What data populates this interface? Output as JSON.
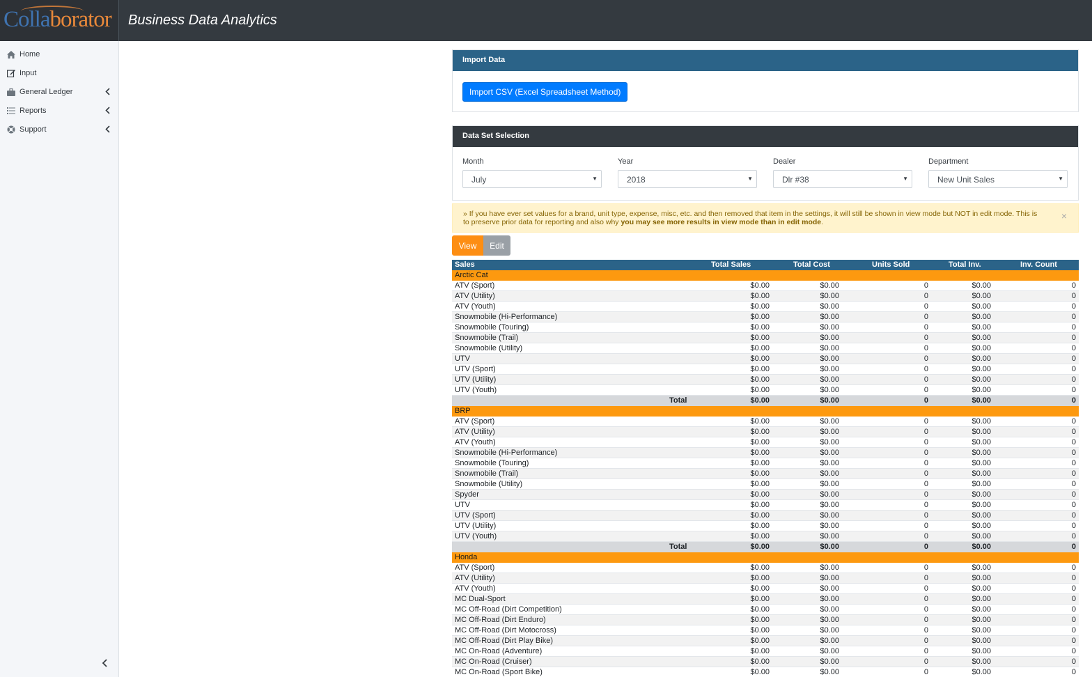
{
  "header": {
    "logo_part1": "Colla",
    "logo_part2": "borator",
    "title": "Business Data Analytics"
  },
  "sidebar": {
    "items": [
      {
        "label": "Home",
        "icon": "home-icon",
        "has_chevron": false
      },
      {
        "label": "Input",
        "icon": "edit-icon",
        "has_chevron": false
      },
      {
        "label": "General Ledger",
        "icon": "briefcase-icon",
        "has_chevron": true
      },
      {
        "label": "Reports",
        "icon": "list-icon",
        "has_chevron": true
      },
      {
        "label": "Support",
        "icon": "support-icon",
        "has_chevron": true
      }
    ]
  },
  "import_card": {
    "title": "Import Data",
    "button_label": "Import CSV (Excel Spreadsheet Method)"
  },
  "dataset_card": {
    "title": "Data Set Selection",
    "fields": [
      {
        "label": "Month",
        "value": "July"
      },
      {
        "label": "Year",
        "value": "2018"
      },
      {
        "label": "Dealer",
        "value": "Dlr #38"
      },
      {
        "label": "Department",
        "value": "New Unit Sales"
      }
    ]
  },
  "alert": {
    "text_main": "» If you have ever set values for a brand, unit type, expense, misc, etc. and then removed that item in the settings, it will still be shown in view mode but NOT in edit mode. This is to preserve prior data for reporting and also why ",
    "text_bold": "you may see more results in view mode than in edit mode",
    "text_end": ".",
    "close": "×"
  },
  "mode_toggle": {
    "view_label": "View",
    "edit_label": "Edit",
    "active": "View"
  },
  "table": {
    "headers": [
      "Sales",
      "Total Sales",
      "Total Cost",
      "Units Sold",
      "Total Inv.",
      "Inv. Count"
    ],
    "total_label": "Total",
    "groups": [
      {
        "brand": "Arctic Cat",
        "rows": [
          {
            "name": "ATV (Sport)",
            "sales": "$0.00",
            "cost": "$0.00",
            "units": "0",
            "inv": "$0.00",
            "inv_count": "0"
          },
          {
            "name": "ATV (Utility)",
            "sales": "$0.00",
            "cost": "$0.00",
            "units": "0",
            "inv": "$0.00",
            "inv_count": "0"
          },
          {
            "name": "ATV (Youth)",
            "sales": "$0.00",
            "cost": "$0.00",
            "units": "0",
            "inv": "$0.00",
            "inv_count": "0"
          },
          {
            "name": "Snowmobile (Hi-Performance)",
            "sales": "$0.00",
            "cost": "$0.00",
            "units": "0",
            "inv": "$0.00",
            "inv_count": "0"
          },
          {
            "name": "Snowmobile (Touring)",
            "sales": "$0.00",
            "cost": "$0.00",
            "units": "0",
            "inv": "$0.00",
            "inv_count": "0"
          },
          {
            "name": "Snowmobile (Trail)",
            "sales": "$0.00",
            "cost": "$0.00",
            "units": "0",
            "inv": "$0.00",
            "inv_count": "0"
          },
          {
            "name": "Snowmobile (Utility)",
            "sales": "$0.00",
            "cost": "$0.00",
            "units": "0",
            "inv": "$0.00",
            "inv_count": "0"
          },
          {
            "name": "UTV",
            "sales": "$0.00",
            "cost": "$0.00",
            "units": "0",
            "inv": "$0.00",
            "inv_count": "0"
          },
          {
            "name": "UTV (Sport)",
            "sales": "$0.00",
            "cost": "$0.00",
            "units": "0",
            "inv": "$0.00",
            "inv_count": "0"
          },
          {
            "name": "UTV (Utility)",
            "sales": "$0.00",
            "cost": "$0.00",
            "units": "0",
            "inv": "$0.00",
            "inv_count": "0"
          },
          {
            "name": "UTV (Youth)",
            "sales": "$0.00",
            "cost": "$0.00",
            "units": "0",
            "inv": "$0.00",
            "inv_count": "0"
          }
        ],
        "total": {
          "sales": "$0.00",
          "cost": "$0.00",
          "units": "0",
          "inv": "$0.00",
          "inv_count": "0"
        }
      },
      {
        "brand": "BRP",
        "rows": [
          {
            "name": "ATV (Sport)",
            "sales": "$0.00",
            "cost": "$0.00",
            "units": "0",
            "inv": "$0.00",
            "inv_count": "0"
          },
          {
            "name": "ATV (Utility)",
            "sales": "$0.00",
            "cost": "$0.00",
            "units": "0",
            "inv": "$0.00",
            "inv_count": "0"
          },
          {
            "name": "ATV (Youth)",
            "sales": "$0.00",
            "cost": "$0.00",
            "units": "0",
            "inv": "$0.00",
            "inv_count": "0"
          },
          {
            "name": "Snowmobile (Hi-Performance)",
            "sales": "$0.00",
            "cost": "$0.00",
            "units": "0",
            "inv": "$0.00",
            "inv_count": "0"
          },
          {
            "name": "Snowmobile (Touring)",
            "sales": "$0.00",
            "cost": "$0.00",
            "units": "0",
            "inv": "$0.00",
            "inv_count": "0"
          },
          {
            "name": "Snowmobile (Trail)",
            "sales": "$0.00",
            "cost": "$0.00",
            "units": "0",
            "inv": "$0.00",
            "inv_count": "0"
          },
          {
            "name": "Snowmobile (Utility)",
            "sales": "$0.00",
            "cost": "$0.00",
            "units": "0",
            "inv": "$0.00",
            "inv_count": "0"
          },
          {
            "name": "Spyder",
            "sales": "$0.00",
            "cost": "$0.00",
            "units": "0",
            "inv": "$0.00",
            "inv_count": "0"
          },
          {
            "name": "UTV",
            "sales": "$0.00",
            "cost": "$0.00",
            "units": "0",
            "inv": "$0.00",
            "inv_count": "0"
          },
          {
            "name": "UTV (Sport)",
            "sales": "$0.00",
            "cost": "$0.00",
            "units": "0",
            "inv": "$0.00",
            "inv_count": "0"
          },
          {
            "name": "UTV (Utility)",
            "sales": "$0.00",
            "cost": "$0.00",
            "units": "0",
            "inv": "$0.00",
            "inv_count": "0"
          },
          {
            "name": "UTV (Youth)",
            "sales": "$0.00",
            "cost": "$0.00",
            "units": "0",
            "inv": "$0.00",
            "inv_count": "0"
          }
        ],
        "total": {
          "sales": "$0.00",
          "cost": "$0.00",
          "units": "0",
          "inv": "$0.00",
          "inv_count": "0"
        }
      },
      {
        "brand": "Honda",
        "rows": [
          {
            "name": "ATV (Sport)",
            "sales": "$0.00",
            "cost": "$0.00",
            "units": "0",
            "inv": "$0.00",
            "inv_count": "0"
          },
          {
            "name": "ATV (Utility)",
            "sales": "$0.00",
            "cost": "$0.00",
            "units": "0",
            "inv": "$0.00",
            "inv_count": "0"
          },
          {
            "name": "ATV (Youth)",
            "sales": "$0.00",
            "cost": "$0.00",
            "units": "0",
            "inv": "$0.00",
            "inv_count": "0"
          },
          {
            "name": "MC Dual-Sport",
            "sales": "$0.00",
            "cost": "$0.00",
            "units": "0",
            "inv": "$0.00",
            "inv_count": "0"
          },
          {
            "name": "MC Off-Road (Dirt Competition)",
            "sales": "$0.00",
            "cost": "$0.00",
            "units": "0",
            "inv": "$0.00",
            "inv_count": "0"
          },
          {
            "name": "MC Off-Road (Dirt Enduro)",
            "sales": "$0.00",
            "cost": "$0.00",
            "units": "0",
            "inv": "$0.00",
            "inv_count": "0"
          },
          {
            "name": "MC Off-Road (Dirt Motocross)",
            "sales": "$0.00",
            "cost": "$0.00",
            "units": "0",
            "inv": "$0.00",
            "inv_count": "0"
          },
          {
            "name": "MC Off-Road (Dirt Play Bike)",
            "sales": "$0.00",
            "cost": "$0.00",
            "units": "0",
            "inv": "$0.00",
            "inv_count": "0"
          },
          {
            "name": "MC On-Road (Adventure)",
            "sales": "$0.00",
            "cost": "$0.00",
            "units": "0",
            "inv": "$0.00",
            "inv_count": "0"
          },
          {
            "name": "MC On-Road (Cruiser)",
            "sales": "$0.00",
            "cost": "$0.00",
            "units": "0",
            "inv": "$0.00",
            "inv_count": "0"
          },
          {
            "name": "MC On-Road (Sport Bike)",
            "sales": "$0.00",
            "cost": "$0.00",
            "units": "0",
            "inv": "$0.00",
            "inv_count": "0"
          }
        ]
      }
    ]
  }
}
